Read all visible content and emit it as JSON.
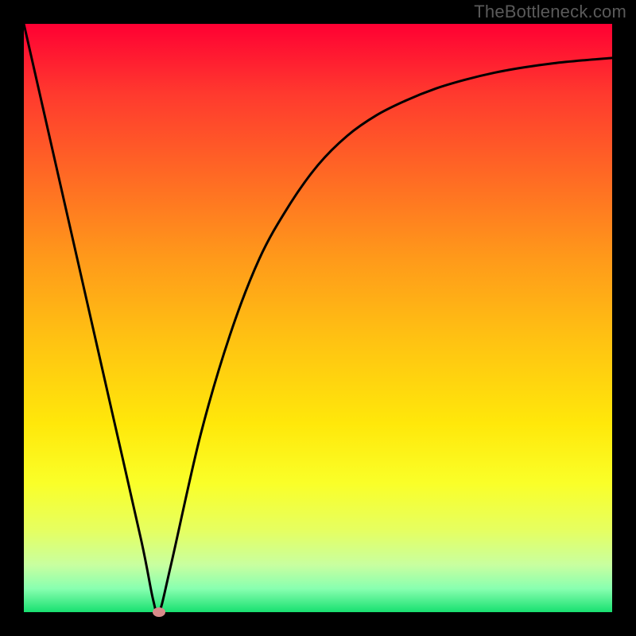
{
  "watermark": "TheBottleneck.com",
  "chart_data": {
    "type": "line",
    "title": "",
    "xlabel": "",
    "ylabel": "",
    "xlim": [
      0,
      100
    ],
    "ylim": [
      0,
      100
    ],
    "grid": false,
    "legend": false,
    "series": [
      {
        "name": "bottleneck-curve",
        "x": [
          0,
          5,
          10,
          15,
          20,
          22,
          23,
          25,
          30,
          35,
          40,
          45,
          50,
          55,
          60,
          65,
          70,
          75,
          80,
          85,
          90,
          95,
          100
        ],
        "y": [
          100,
          78,
          56,
          34,
          12,
          2,
          0,
          8,
          30,
          47,
          60,
          69,
          76,
          81,
          84.5,
          87,
          89,
          90.5,
          91.7,
          92.6,
          93.3,
          93.8,
          94.2
        ]
      }
    ],
    "marker": {
      "name": "optimal-point",
      "x": 23,
      "y": 0,
      "color": "#d88a8a"
    },
    "background_gradient": {
      "top": "#ff0033",
      "bottom": "#18e070"
    }
  }
}
